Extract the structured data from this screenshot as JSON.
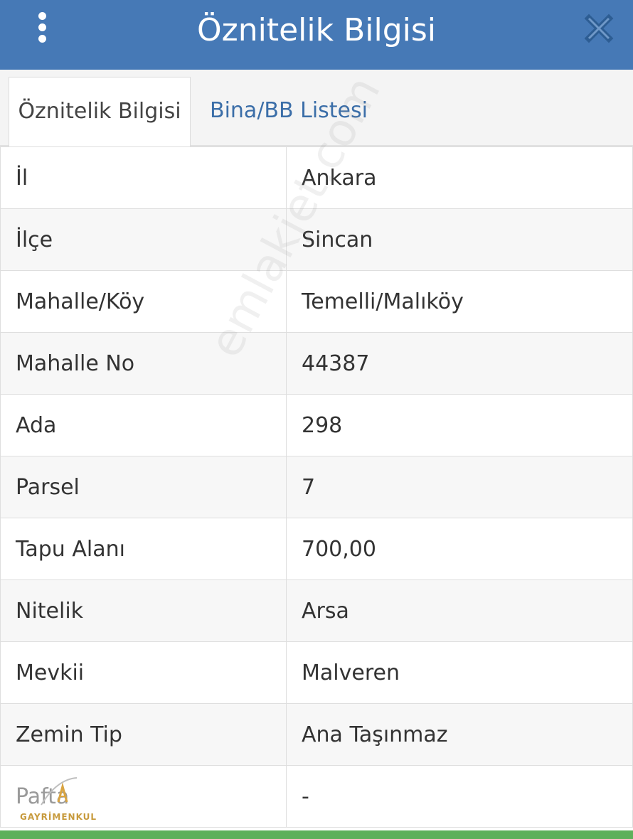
{
  "header": {
    "title": "Öznitelik Bilgisi",
    "menu_icon": "more-vertical-icon",
    "close_icon": "close-icon",
    "background_color": "#4679b6"
  },
  "tabs": [
    {
      "label": "Öznitelik Bilgisi",
      "active": true
    },
    {
      "label": "Bina/BB Listesi",
      "active": false
    }
  ],
  "rows": [
    {
      "key": "İl",
      "value": "Ankara"
    },
    {
      "key": "İlçe",
      "value": "Sincan"
    },
    {
      "key": "Mahalle/Köy",
      "value": "Temelli/Malıköy"
    },
    {
      "key": "Mahalle No",
      "value": "44387"
    },
    {
      "key": "Ada",
      "value": "298"
    },
    {
      "key": "Parsel",
      "value": "7"
    },
    {
      "key": "Tapu Alanı",
      "value": "700,00"
    },
    {
      "key": "Nitelik",
      "value": "Arsa"
    },
    {
      "key": "Mevkii",
      "value": "Malveren"
    },
    {
      "key": "Zemin Tip",
      "value": "Ana Taşınmaz"
    },
    {
      "key": "Pafta",
      "value": "-"
    }
  ],
  "watermark": {
    "text": "emlakjet.com",
    "logo_text": "GAYRİMENKUL"
  },
  "accent_colors": {
    "tab_link": "#3b6ea8",
    "bottom_bar": "#5db05a"
  }
}
